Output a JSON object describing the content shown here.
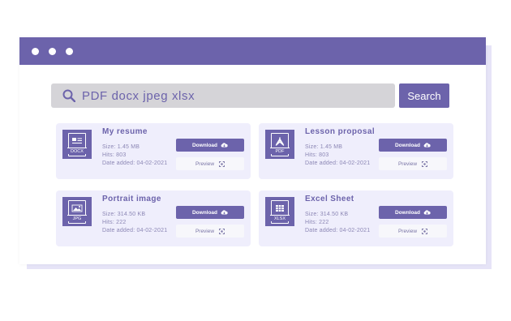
{
  "search": {
    "value": "PDF docx jpeg xlsx",
    "button_label": "Search"
  },
  "labels": {
    "download": "Download",
    "preview": "Preview"
  },
  "colors": {
    "accent": "#6c63ab",
    "card_bg": "#efeefc",
    "search_bg": "#d5d4d8"
  },
  "files": [
    {
      "title": "My resume",
      "icon": "docx-file-icon",
      "ext": "DOCX",
      "size": "Size: 1.45 MB",
      "hits": "Hits: 803",
      "date": "Date added: 04-02-2021"
    },
    {
      "title": "Lesson proposal",
      "icon": "pdf-file-icon",
      "ext": "PDF",
      "size": "Size: 1.45 MB",
      "hits": "Hits: 803",
      "date": "Date added: 04-02-2021"
    },
    {
      "title": "Portrait image",
      "icon": "jpg-file-icon",
      "ext": "JPG",
      "size": "Size: 314.50 KB",
      "hits": "Hits: 222",
      "date": "Date added: 04-02-2021"
    },
    {
      "title": "Excel Sheet",
      "icon": "xlsx-file-icon",
      "ext": "XLSX",
      "size": "Size: 314.50 KB",
      "hits": "Hits: 222",
      "date": "Date added: 04-02-2021"
    }
  ]
}
